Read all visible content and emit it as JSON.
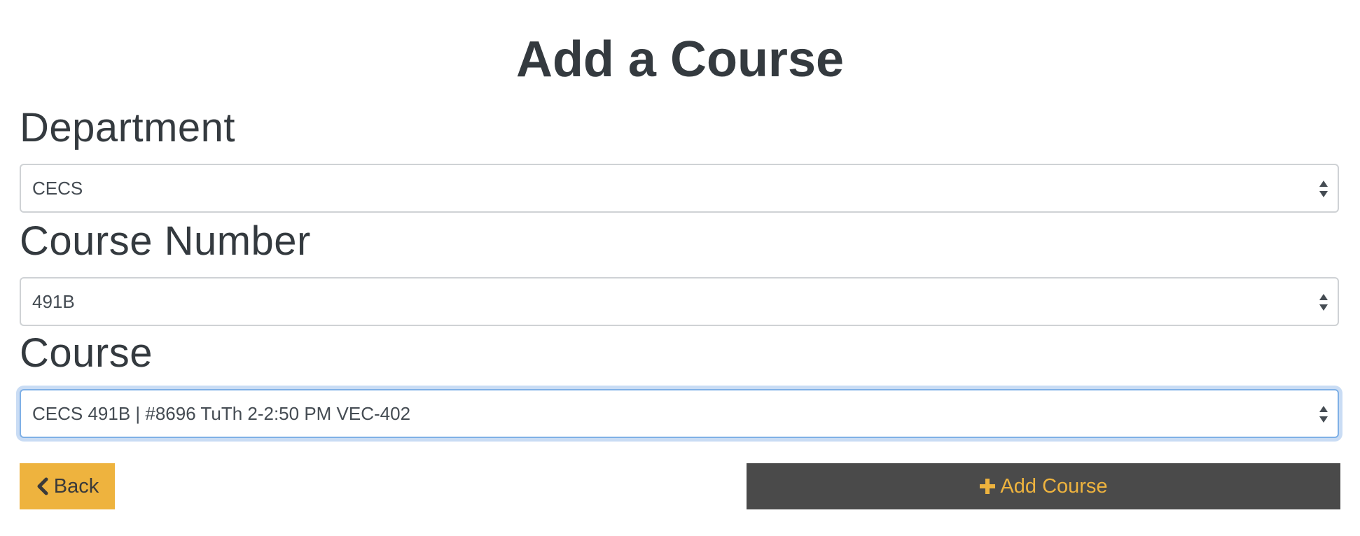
{
  "page": {
    "title": "Add a Course"
  },
  "form": {
    "department": {
      "label": "Department",
      "selected": "CECS"
    },
    "course_number": {
      "label": "Course Number",
      "selected": "491B"
    },
    "course": {
      "label": "Course",
      "selected": "CECS 491B | #8696 TuTh 2-2:50 PM VEC-402"
    }
  },
  "actions": {
    "back_label": "Back",
    "back_icon": "chevron-left-icon",
    "add_label": "Add Course",
    "add_icon": "plus-icon"
  },
  "colors": {
    "accent": "#eeb33e",
    "dark_button": "#4a4a4a",
    "focus_ring": "#c9dcf4"
  }
}
